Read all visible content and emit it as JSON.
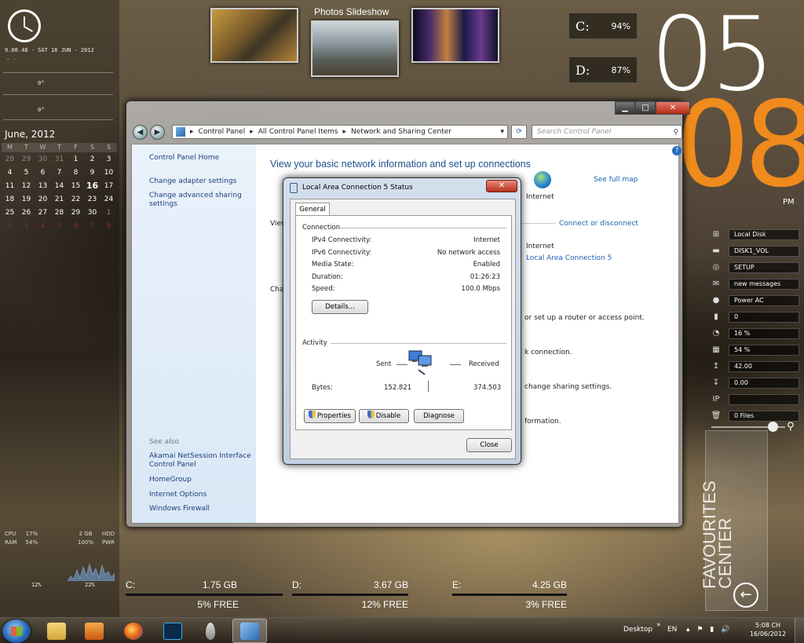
{
  "left_gadgets": {
    "clock_line": "9.08.48 - SAT        16 JUN - 2012",
    "clock_dots": ". .",
    "temp_1": "0°",
    "temp_2": "0°",
    "calendar": {
      "title": "June, 2012",
      "headers": [
        "M",
        "T",
        "W",
        "T",
        "F",
        "S",
        "S"
      ],
      "weeks": [
        [
          "28",
          "29",
          "30",
          "31",
          "1",
          "2",
          "3"
        ],
        [
          "4",
          "5",
          "6",
          "7",
          "8",
          "9",
          "10"
        ],
        [
          "11",
          "12",
          "13",
          "14",
          "15",
          "16",
          "17"
        ],
        [
          "18",
          "19",
          "20",
          "21",
          "22",
          "23",
          "24"
        ],
        [
          "25",
          "26",
          "27",
          "28",
          "29",
          "30",
          "1"
        ],
        [
          "2",
          "3",
          "4",
          "5",
          "6",
          "7",
          "8"
        ]
      ]
    },
    "stats": {
      "cpu_label": "CPU",
      "cpu_value": "17%",
      "ram_label": "RAM",
      "ram_value": "54%",
      "mem_total": "2 GB",
      "hdd_label": "HDD",
      "pwr_value": "100%",
      "pwr_label": "PWR",
      "graph_left": "12%",
      "graph_right": "22%"
    }
  },
  "photos": {
    "title": "Photos Slideshow"
  },
  "drive_widgets": [
    {
      "letter": "C:",
      "value": "94%"
    },
    {
      "letter": "D:",
      "value": "87%"
    }
  ],
  "big_clock": {
    "hour": "05",
    "minute": "08",
    "ampm": "PM"
  },
  "system_list": [
    {
      "icon": "windows-icon",
      "glyph": "⊞",
      "value": "Local Disk"
    },
    {
      "icon": "drive-icon",
      "glyph": "▬",
      "value": "DISK1_VOL"
    },
    {
      "icon": "disc-icon",
      "glyph": "◎",
      "value": "SETUP"
    },
    {
      "icon": "mail-icon",
      "glyph": "✉",
      "value": "new messages"
    },
    {
      "icon": "power-icon",
      "glyph": "●",
      "value": "Power AC"
    },
    {
      "icon": "signal-icon",
      "glyph": "▮",
      "value": "0"
    },
    {
      "icon": "cpu-gauge-icon",
      "glyph": "◔",
      "value": "16  %"
    },
    {
      "icon": "ram-icon",
      "glyph": "▦",
      "value": "54  %"
    },
    {
      "icon": "upload-icon",
      "glyph": "↥",
      "value": "42.00"
    },
    {
      "icon": "download-icon",
      "glyph": "↧",
      "value": "0.00"
    },
    {
      "icon": "ip-icon",
      "glyph": "IP",
      "value": ""
    },
    {
      "icon": "recycle-bin-icon",
      "glyph": "🗑",
      "value": "0 Files"
    }
  ],
  "favourites": {
    "line1": "FAVOURITES",
    "line2": "CENTER",
    "back_glyph": "←"
  },
  "bottom_drives": [
    {
      "letter": "C:",
      "size": "1.75 GB",
      "free": "5% FREE"
    },
    {
      "letter": "D:",
      "size": "3.67 GB",
      "free": "12% FREE"
    },
    {
      "letter": "E:",
      "size": "4.25 GB",
      "free": "3% FREE"
    }
  ],
  "explorer": {
    "controls": {
      "minimize": "▁",
      "maximize": "□",
      "close": "✕"
    },
    "breadcrumb": [
      "Control Panel",
      "All Control Panel Items",
      "Network and Sharing Center"
    ],
    "search_placeholder": "Search Control Panel",
    "left_pane": {
      "home": "Control Panel Home",
      "links": [
        "Change adapter settings",
        "Change advanced sharing settings"
      ],
      "see_also_label": "See also",
      "see_also": [
        "Akamai NetSession Interface Control Panel",
        "HomeGroup",
        "Internet Options",
        "Windows Firewall"
      ]
    },
    "main": {
      "title": "View your basic network information and set up connections",
      "see_full_map": "See full map",
      "internet_label": "Internet",
      "connect_disconnect": "Connect or disconnect",
      "view_partial": "View",
      "change_partial": "Cha",
      "access_type": "Internet",
      "connection_link": "Local Area Connection 5",
      "partial_1": "or set up a router or access point.",
      "partial_2": "k connection.",
      "partial_3": "change sharing settings.",
      "partial_4": "formation."
    }
  },
  "status_dialog": {
    "title": "Local Area Connection 5 Status",
    "close_glyph": "✕",
    "tab": "General",
    "connection_group": "Connection",
    "rows": [
      {
        "label": "IPv4 Connectivity:",
        "value": "Internet"
      },
      {
        "label": "IPv6 Connectivity:",
        "value": "No network access"
      },
      {
        "label": "Media State:",
        "value": "Enabled"
      },
      {
        "label": "Duration:",
        "value": "01:26:23"
      },
      {
        "label": "Speed:",
        "value": "100.0 Mbps"
      }
    ],
    "details_button": "Details...",
    "activity_group": "Activity",
    "sent_label": "Sent",
    "received_label": "Received",
    "bytes_label": "Bytes:",
    "bytes_sent": "152.821",
    "bytes_received": "374.503",
    "properties_button": "Properties",
    "disable_button": "Disable",
    "diagnose_button": "Diagnose",
    "close_button": "Close"
  },
  "taskbar": {
    "desktop_label": "Desktop",
    "chevron": "»",
    "lang": "EN",
    "tray_glyphs": "▴ ⚑ ▮ 🔊",
    "time": "5:08 CH",
    "date": "16/06/2012"
  }
}
